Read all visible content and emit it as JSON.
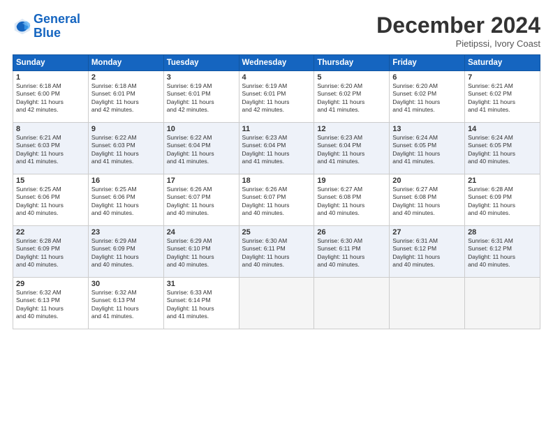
{
  "logo": {
    "line1": "General",
    "line2": "Blue"
  },
  "title": "December 2024",
  "location": "Pietipssi, Ivory Coast",
  "headers": [
    "Sunday",
    "Monday",
    "Tuesday",
    "Wednesday",
    "Thursday",
    "Friday",
    "Saturday"
  ],
  "weeks": [
    [
      {
        "day": "1",
        "info": "Sunrise: 6:18 AM\nSunset: 6:00 PM\nDaylight: 11 hours\nand 42 minutes."
      },
      {
        "day": "2",
        "info": "Sunrise: 6:18 AM\nSunset: 6:01 PM\nDaylight: 11 hours\nand 42 minutes."
      },
      {
        "day": "3",
        "info": "Sunrise: 6:19 AM\nSunset: 6:01 PM\nDaylight: 11 hours\nand 42 minutes."
      },
      {
        "day": "4",
        "info": "Sunrise: 6:19 AM\nSunset: 6:01 PM\nDaylight: 11 hours\nand 42 minutes."
      },
      {
        "day": "5",
        "info": "Sunrise: 6:20 AM\nSunset: 6:02 PM\nDaylight: 11 hours\nand 41 minutes."
      },
      {
        "day": "6",
        "info": "Sunrise: 6:20 AM\nSunset: 6:02 PM\nDaylight: 11 hours\nand 41 minutes."
      },
      {
        "day": "7",
        "info": "Sunrise: 6:21 AM\nSunset: 6:02 PM\nDaylight: 11 hours\nand 41 minutes."
      }
    ],
    [
      {
        "day": "8",
        "info": "Sunrise: 6:21 AM\nSunset: 6:03 PM\nDaylight: 11 hours\nand 41 minutes."
      },
      {
        "day": "9",
        "info": "Sunrise: 6:22 AM\nSunset: 6:03 PM\nDaylight: 11 hours\nand 41 minutes."
      },
      {
        "day": "10",
        "info": "Sunrise: 6:22 AM\nSunset: 6:04 PM\nDaylight: 11 hours\nand 41 minutes."
      },
      {
        "day": "11",
        "info": "Sunrise: 6:23 AM\nSunset: 6:04 PM\nDaylight: 11 hours\nand 41 minutes."
      },
      {
        "day": "12",
        "info": "Sunrise: 6:23 AM\nSunset: 6:04 PM\nDaylight: 11 hours\nand 41 minutes."
      },
      {
        "day": "13",
        "info": "Sunrise: 6:24 AM\nSunset: 6:05 PM\nDaylight: 11 hours\nand 41 minutes."
      },
      {
        "day": "14",
        "info": "Sunrise: 6:24 AM\nSunset: 6:05 PM\nDaylight: 11 hours\nand 40 minutes."
      }
    ],
    [
      {
        "day": "15",
        "info": "Sunrise: 6:25 AM\nSunset: 6:06 PM\nDaylight: 11 hours\nand 40 minutes."
      },
      {
        "day": "16",
        "info": "Sunrise: 6:25 AM\nSunset: 6:06 PM\nDaylight: 11 hours\nand 40 minutes."
      },
      {
        "day": "17",
        "info": "Sunrise: 6:26 AM\nSunset: 6:07 PM\nDaylight: 11 hours\nand 40 minutes."
      },
      {
        "day": "18",
        "info": "Sunrise: 6:26 AM\nSunset: 6:07 PM\nDaylight: 11 hours\nand 40 minutes."
      },
      {
        "day": "19",
        "info": "Sunrise: 6:27 AM\nSunset: 6:08 PM\nDaylight: 11 hours\nand 40 minutes."
      },
      {
        "day": "20",
        "info": "Sunrise: 6:27 AM\nSunset: 6:08 PM\nDaylight: 11 hours\nand 40 minutes."
      },
      {
        "day": "21",
        "info": "Sunrise: 6:28 AM\nSunset: 6:09 PM\nDaylight: 11 hours\nand 40 minutes."
      }
    ],
    [
      {
        "day": "22",
        "info": "Sunrise: 6:28 AM\nSunset: 6:09 PM\nDaylight: 11 hours\nand 40 minutes."
      },
      {
        "day": "23",
        "info": "Sunrise: 6:29 AM\nSunset: 6:09 PM\nDaylight: 11 hours\nand 40 minutes."
      },
      {
        "day": "24",
        "info": "Sunrise: 6:29 AM\nSunset: 6:10 PM\nDaylight: 11 hours\nand 40 minutes."
      },
      {
        "day": "25",
        "info": "Sunrise: 6:30 AM\nSunset: 6:11 PM\nDaylight: 11 hours\nand 40 minutes."
      },
      {
        "day": "26",
        "info": "Sunrise: 6:30 AM\nSunset: 6:11 PM\nDaylight: 11 hours\nand 40 minutes."
      },
      {
        "day": "27",
        "info": "Sunrise: 6:31 AM\nSunset: 6:12 PM\nDaylight: 11 hours\nand 40 minutes."
      },
      {
        "day": "28",
        "info": "Sunrise: 6:31 AM\nSunset: 6:12 PM\nDaylight: 11 hours\nand 40 minutes."
      }
    ],
    [
      {
        "day": "29",
        "info": "Sunrise: 6:32 AM\nSunset: 6:13 PM\nDaylight: 11 hours\nand 40 minutes."
      },
      {
        "day": "30",
        "info": "Sunrise: 6:32 AM\nSunset: 6:13 PM\nDaylight: 11 hours\nand 41 minutes."
      },
      {
        "day": "31",
        "info": "Sunrise: 6:33 AM\nSunset: 6:14 PM\nDaylight: 11 hours\nand 41 minutes."
      },
      null,
      null,
      null,
      null
    ]
  ],
  "row_bg": [
    "#ffffff",
    "#eef2f9",
    "#ffffff",
    "#eef2f9",
    "#ffffff"
  ]
}
